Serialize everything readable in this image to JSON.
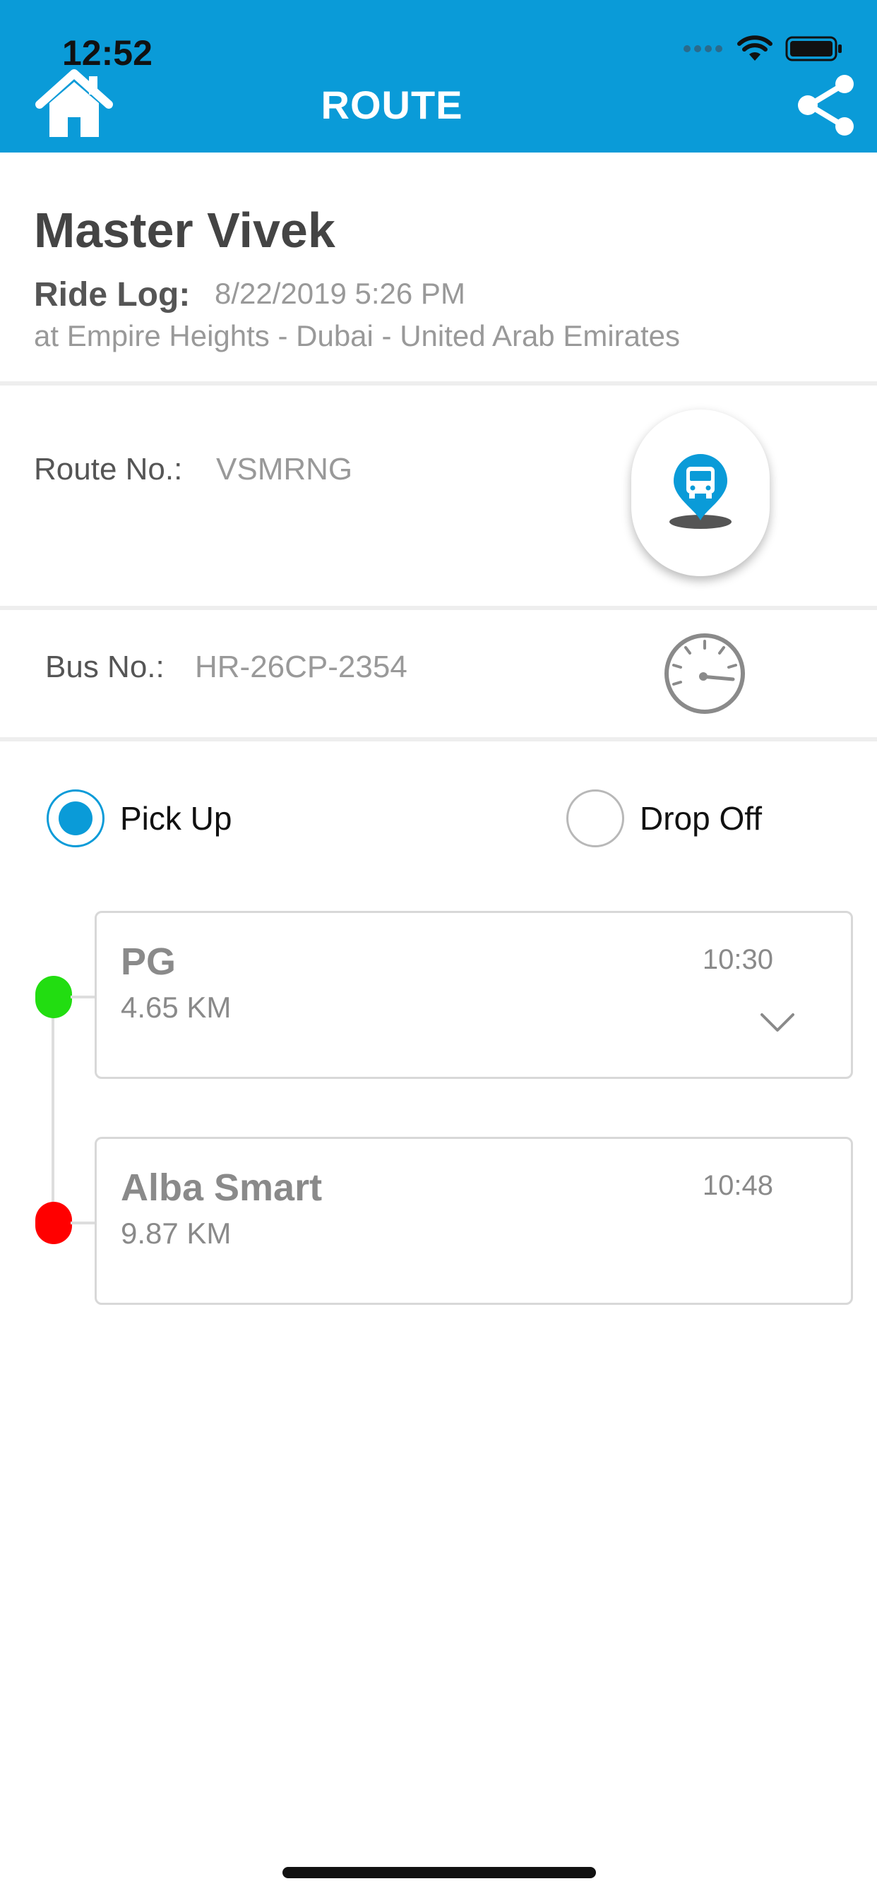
{
  "status_bar": {
    "time": "12:52",
    "icons": [
      "signal-dots-icon",
      "wifi-icon",
      "battery-icon"
    ]
  },
  "header": {
    "title": "ROUTE",
    "left_icon": "home-icon",
    "right_icon": "share-icon",
    "background_color": "#0a9bd8"
  },
  "profile": {
    "name": "Master Vivek",
    "ride_log_label": "Ride Log:",
    "ride_log_value": "8/22/2019 5:26 PM",
    "location": "at Empire Heights - Dubai - United Arab Emirates"
  },
  "route": {
    "label": "Route No.:",
    "value": "VSMRNG",
    "action_icon": "bus-location-icon"
  },
  "bus": {
    "label": "Bus No.:",
    "value": "HR-26CP-2354",
    "icon": "speedometer-icon"
  },
  "trip_type": {
    "options": [
      {
        "label": "Pick Up",
        "selected": true
      },
      {
        "label": "Drop Off",
        "selected": false
      }
    ]
  },
  "stops": [
    {
      "name": "PG",
      "distance": "4.65 KM",
      "time": "10:30",
      "dot_color": "#22dd11",
      "expandable": true
    },
    {
      "name": "Alba Smart",
      "distance": "9.87 KM",
      "time": "10:48",
      "dot_color": "#ff0000",
      "expandable": false
    }
  ]
}
